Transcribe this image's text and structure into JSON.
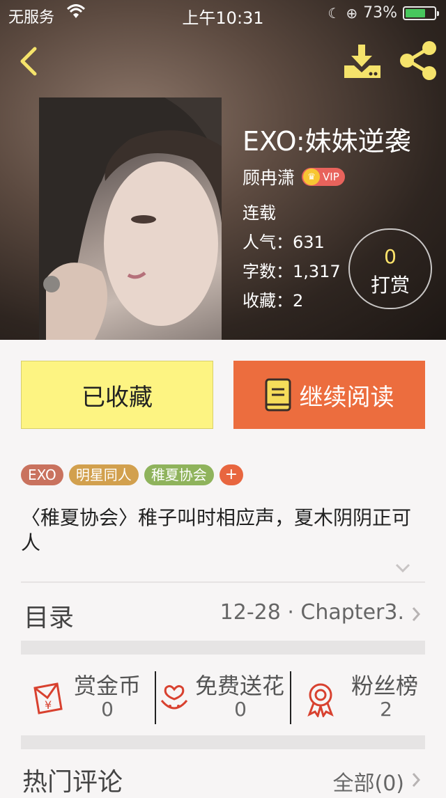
{
  "status_bar": {
    "carrier": "无服务",
    "time": "上午10:31",
    "battery": "73%",
    "battery_level": 0.73
  },
  "book": {
    "title": "EXO:妹妹逆袭",
    "author": "顾冉潇",
    "vip_label": "VIP",
    "status": "连载",
    "popularity": "人气：631",
    "word_count": "字数：1,317",
    "favorites": "收藏：2"
  },
  "reward": {
    "count": "0",
    "label": "打赏"
  },
  "actions": {
    "favorited_label": "已收藏",
    "continue_label": "继续阅读"
  },
  "tags": [
    {
      "label": "EXO",
      "color": "#c9725e"
    },
    {
      "label": "明星同人",
      "color": "#d2a04e"
    },
    {
      "label": "稚夏协会",
      "color": "#8fb35c"
    }
  ],
  "tag_add": "+",
  "description": "〈稚夏协会〉稚子叫时相应声，夏木阴阴正可人",
  "toc": {
    "label": "目录",
    "latest": "12-28 · Chapter3."
  },
  "stats": [
    {
      "label": "赏金币",
      "value": "0",
      "icon": "red-envelope-icon"
    },
    {
      "label": "免费送花",
      "value": "0",
      "icon": "flower-icon"
    },
    {
      "label": "粉丝榜",
      "value": "2",
      "icon": "medal-icon"
    }
  ],
  "comments": {
    "title": "热门评论",
    "all_label": "全部(0)"
  },
  "colors": {
    "accent_orange": "#ec6d3e",
    "accent_yellow": "#fdf482",
    "icon_yellow": "#f5e36b",
    "icon_red": "#d8412f"
  }
}
